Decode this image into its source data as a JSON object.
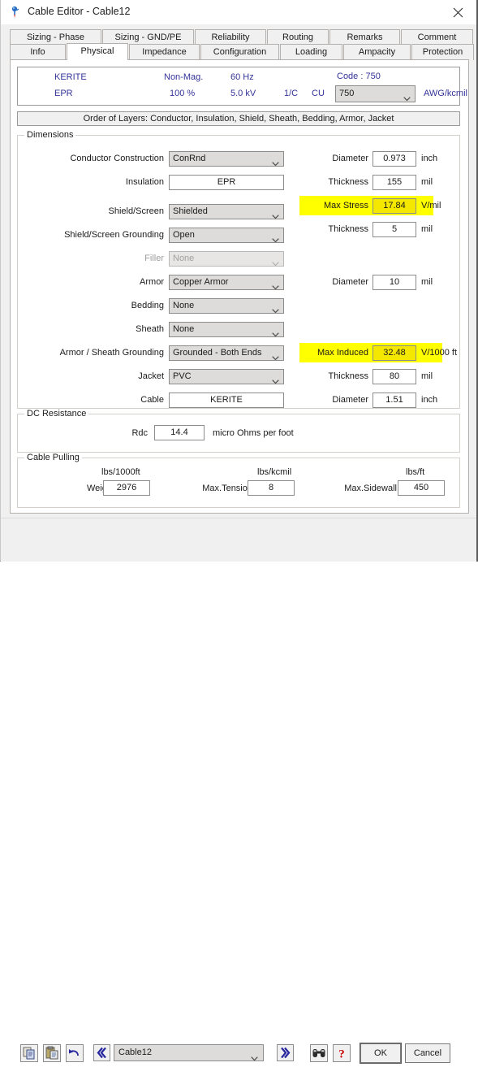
{
  "window": {
    "title": "Cable Editor - Cable12",
    "app_icon": "pushpin-icon",
    "close_icon": "close-icon"
  },
  "tabs": {
    "top_row": [
      {
        "label": "Sizing - Phase",
        "active": false
      },
      {
        "label": "Sizing - GND/PE",
        "active": false
      },
      {
        "label": "Reliability",
        "active": false
      },
      {
        "label": "Routing",
        "active": false
      },
      {
        "label": "Remarks",
        "active": false
      },
      {
        "label": "Comment",
        "active": false
      }
    ],
    "bottom_row": [
      {
        "label": "Info",
        "active": false
      },
      {
        "label": "Physical",
        "active": true
      },
      {
        "label": "Impedance",
        "active": false
      },
      {
        "label": "Configuration",
        "active": false
      },
      {
        "label": "Loading",
        "active": false
      },
      {
        "label": "Ampacity",
        "active": false
      },
      {
        "label": "Protection",
        "active": false
      }
    ]
  },
  "header_info": {
    "insulation_name": "KERITE",
    "insulation_type": "EPR",
    "magnetic": "Non-Mag.",
    "percent": "100 %",
    "frequency": "60 Hz",
    "voltage": "5.0 kV",
    "conductors": "1/C",
    "material": "CU",
    "code_label": "Code : 750",
    "size_value": "750",
    "size_unit": "AWG/kcmil"
  },
  "layers_bar": {
    "text": "Order of Layers: Conductor, Insulation, Shield, Sheath, Bedding, Armor, Jacket"
  },
  "dimensions": {
    "group_title": "Dimensions",
    "left_rows": [
      {
        "label": "Conductor Construction",
        "value": "ConRnd",
        "kind": "combo",
        "disabled": false
      },
      {
        "label": "Insulation",
        "value": "EPR",
        "kind": "text",
        "disabled": false
      },
      {
        "label": "Shield/Screen",
        "value": "Shielded",
        "kind": "combo",
        "disabled": false
      },
      {
        "label": "Shield/Screen Grounding",
        "value": "Open",
        "kind": "combo",
        "disabled": false
      },
      {
        "label": "Filler",
        "value": "None",
        "kind": "combo",
        "disabled": true
      },
      {
        "label": "Armor",
        "value": "Copper Armor",
        "kind": "combo",
        "disabled": false
      },
      {
        "label": "Bedding",
        "value": "None",
        "kind": "combo",
        "disabled": false
      },
      {
        "label": "Sheath",
        "value": "None",
        "kind": "combo",
        "disabled": false
      },
      {
        "label": "Armor / Sheath Grounding",
        "value": "Grounded - Both Ends",
        "kind": "combo",
        "disabled": false
      },
      {
        "label": "Jacket",
        "value": "PVC",
        "kind": "combo",
        "disabled": false
      },
      {
        "label": "Cable",
        "value": "KERITE",
        "kind": "text",
        "disabled": false
      }
    ],
    "right_rows": [
      {
        "label": "Diameter",
        "value": "0.973",
        "unit": "inch",
        "highlight": false
      },
      {
        "label": "Thickness",
        "value": "155",
        "unit": "mil",
        "highlight": false
      },
      {
        "label": "Max Stress",
        "value": "17.84",
        "unit": "V/mil",
        "highlight": true
      },
      {
        "label": "Thickness",
        "value": "5",
        "unit": "mil",
        "highlight": false
      },
      {
        "label": "Diameter",
        "value": "10",
        "unit": "mil",
        "highlight": false
      },
      {
        "label": "Max Induced",
        "value": "32.48",
        "unit": "V/1000 ft",
        "highlight": true
      },
      {
        "label": "Thickness",
        "value": "80",
        "unit": "mil",
        "highlight": false
      },
      {
        "label": "Diameter",
        "value": "1.51",
        "unit": "inch",
        "highlight": false
      }
    ]
  },
  "dc_resistance": {
    "group_title": "DC Resistance",
    "label": "Rdc",
    "value": "14.4",
    "unit": "micro Ohms per foot"
  },
  "cable_pulling": {
    "group_title": "Cable Pulling",
    "items": [
      {
        "unit": "lbs/1000ft",
        "label": "Weight",
        "value": "2976"
      },
      {
        "unit": "lbs/kcmil",
        "label": "Max.Tension",
        "value": "8"
      },
      {
        "unit": "lbs/ft",
        "label": "Max.Sidewall",
        "value": "450"
      }
    ]
  },
  "bottom_bar": {
    "copy_icon": "copy-icon",
    "paste_icon": "paste-icon",
    "undo_icon": "undo-icon",
    "prev_icon": "chevron-double-left-icon",
    "next_icon": "chevron-double-right-icon",
    "find_icon": "binoculars-icon",
    "help_icon": "question-mark-icon",
    "cable_selector_value": "Cable12",
    "ok_label": "OK",
    "cancel_label": "Cancel"
  },
  "colors": {
    "highlight": "#ffff00",
    "header_text": "#333399",
    "help_red": "#cc0000",
    "nav_blue": "#26269e"
  }
}
